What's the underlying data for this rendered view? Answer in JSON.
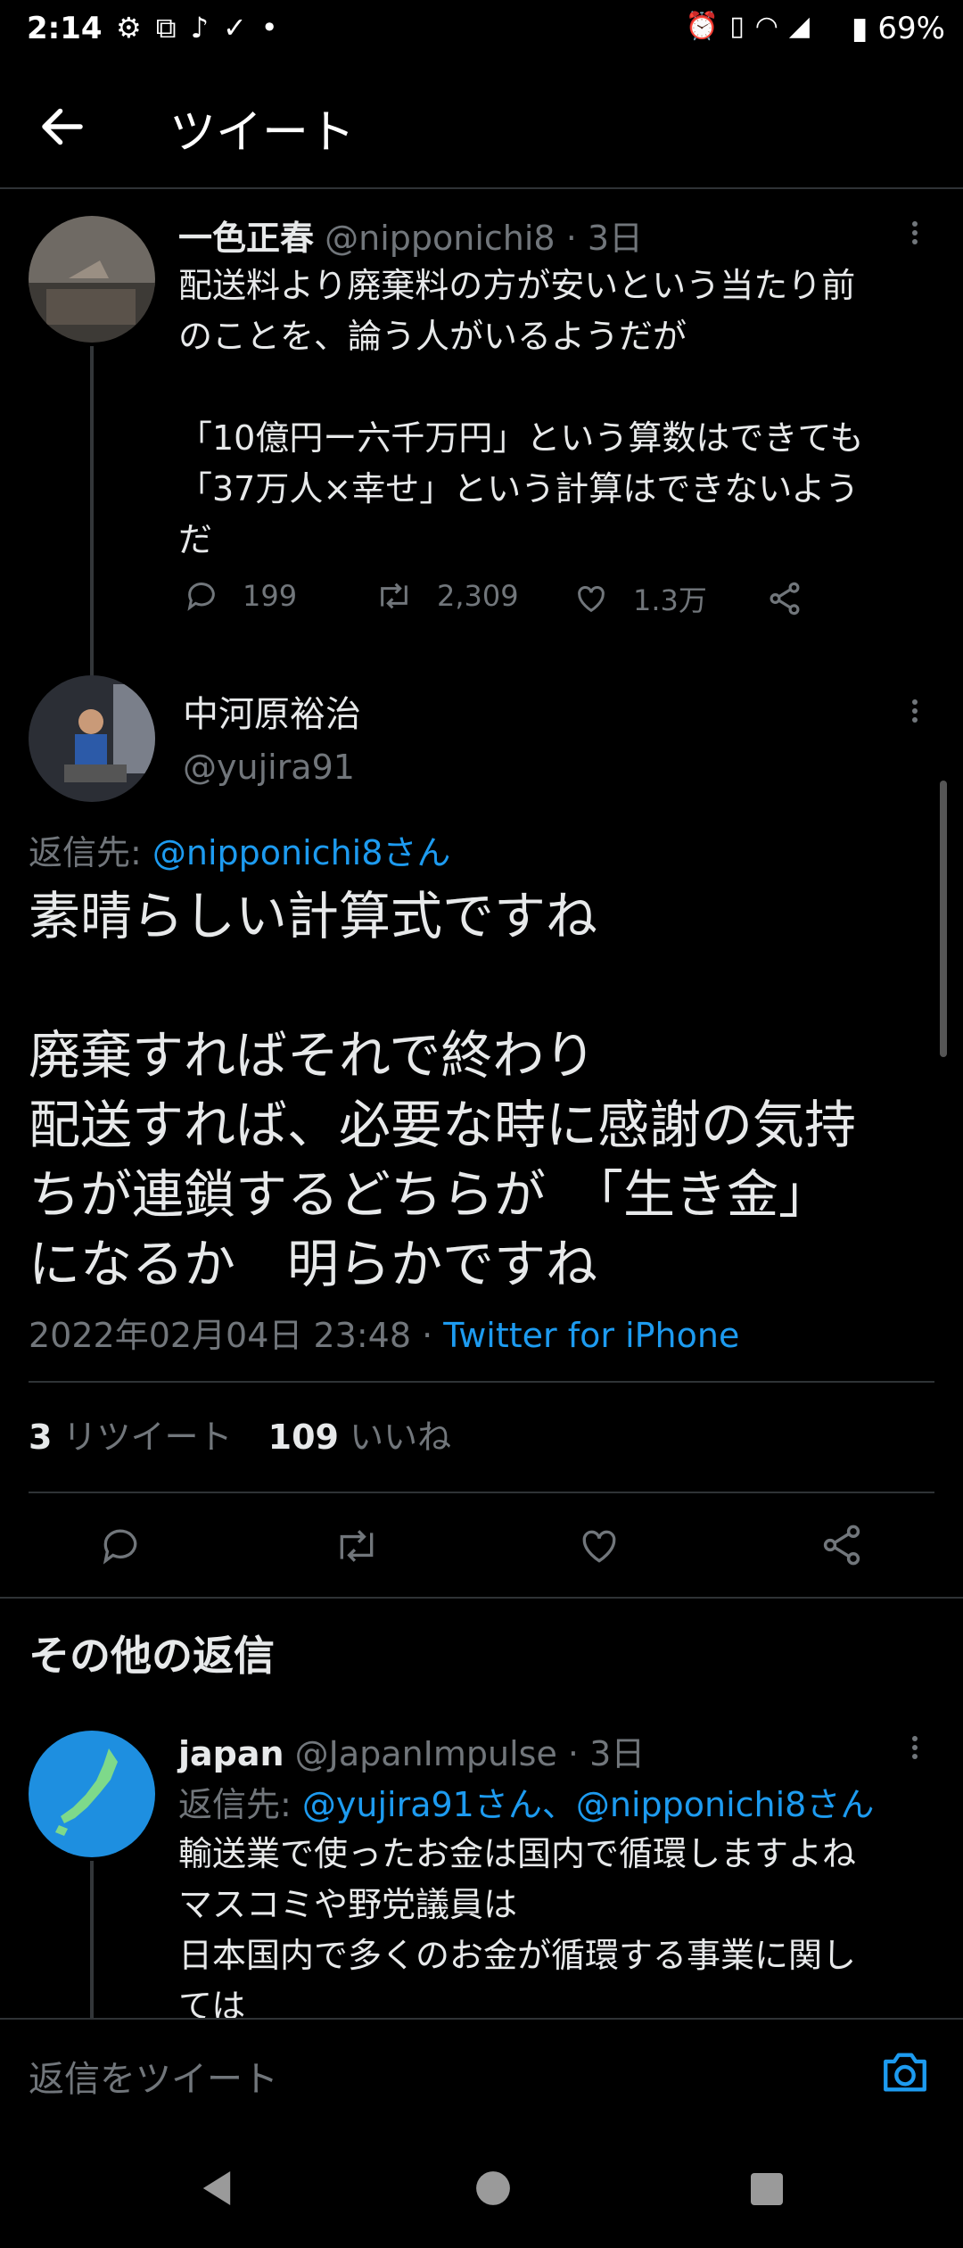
{
  "status_bar": {
    "time": "2:14",
    "left_icons": [
      "gear-icon",
      "app-icon",
      "music-note-icon",
      "checkmark-icon",
      "dot-icon"
    ],
    "right_icons": [
      "alarm-icon",
      "vibrate-icon",
      "wifi-icon",
      "signal-icon"
    ],
    "battery": "69%"
  },
  "header": {
    "title": "ツイート"
  },
  "parent_tweet": {
    "display_name": "一色正春",
    "handle": "@nipponichi8",
    "age": "· 3日",
    "text": "配送料より廃棄料の方が安いという当たり前\nのことを、論う人がいるようだが\n\n「10億円ー六千万円」という算数はできても\n「37万人×幸せ」という計算はできないよう\nだ",
    "replies": "199",
    "retweets": "2,309",
    "likes": "1.3万"
  },
  "main_tweet": {
    "display_name": "中河原裕治",
    "handle": "@yujira91",
    "reply_to_label": "返信先:",
    "reply_to_handle": "@nipponichi8さん",
    "text": "素晴らしい計算式ですね\n\n廃棄すればそれで終わり\n配送すれば、必要な時に感謝の気持\nちが連鎖するどちらが　「生き金」\nになるか　明らかですね",
    "timestamp": "2022年02月04日 23:48",
    "source_sep": "·",
    "source": "Twitter for iPhone",
    "retweet_count": "3",
    "retweet_label": "リツイート",
    "like_count": "109",
    "like_label": "いいね"
  },
  "more_replies": {
    "title": "その他の返信"
  },
  "reply_tweet": {
    "display_name": "japan",
    "handle": "@JapanImpulse",
    "age": "· 3日",
    "reply_to_label": "返信先:",
    "reply_to_handles": "@yujira91さん、@nipponichi8さん",
    "text": "輸送業で使ったお金は国内で循環しますよね\nマスコミや野党議員は\n日本国内で多くのお金が循環する事業に関し\nては"
  },
  "reply_bar": {
    "placeholder": "返信をツイート"
  },
  "colors": {
    "accent": "#1d9bf0",
    "background": "#000000",
    "muted": "#71767b"
  }
}
